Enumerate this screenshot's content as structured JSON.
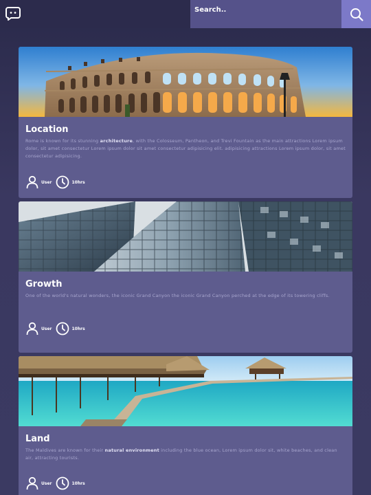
{
  "header": {
    "search_placeholder": "Search..",
    "chat_icon": "chat-bubble-icon",
    "search_icon": "magnifier-icon"
  },
  "colors": {
    "header_bg": "#2c2b4c",
    "search_bg": "#55528a",
    "search_btn_bg": "#7c79c8",
    "card_bg": "#5e5c8e",
    "desc_text": "#a9a7cf"
  },
  "cards": [
    {
      "title": "Location",
      "desc_pre": "Rome is known for its stunning ",
      "desc_bold": "architecture",
      "desc_post": ", with the Colosseum, Pantheon, and Trevi Fountain as the main attractions Lorem ipsum dolor, sit amet consectetur Lorem ipsum dolor sit amet consectetur adipisicing elit. adipisicing attractions Lorem ipsum dolor, sit amet consectetur adipisicing.",
      "user_label": "User",
      "time_label": "10hrs",
      "image": "colosseum-photo"
    },
    {
      "title": "Growth",
      "desc_pre": "One of the world's natural wonders, the iconic Grand Canyon the iconic Grand Canyon perched at the edge of its towering cliffs.",
      "desc_bold": "",
      "desc_post": "",
      "user_label": "User",
      "time_label": "10hrs",
      "image": "skyscrapers-photo"
    },
    {
      "title": "Land",
      "desc_pre": "The Maldives are known for their ",
      "desc_bold": "natural environment",
      "desc_post": " including the blue ocean, Lorem ipsum dolor sit, white beaches, and clean air, attracting tourists.",
      "user_label": "User",
      "time_label": "10hrs",
      "image": "maldives-photo"
    }
  ]
}
